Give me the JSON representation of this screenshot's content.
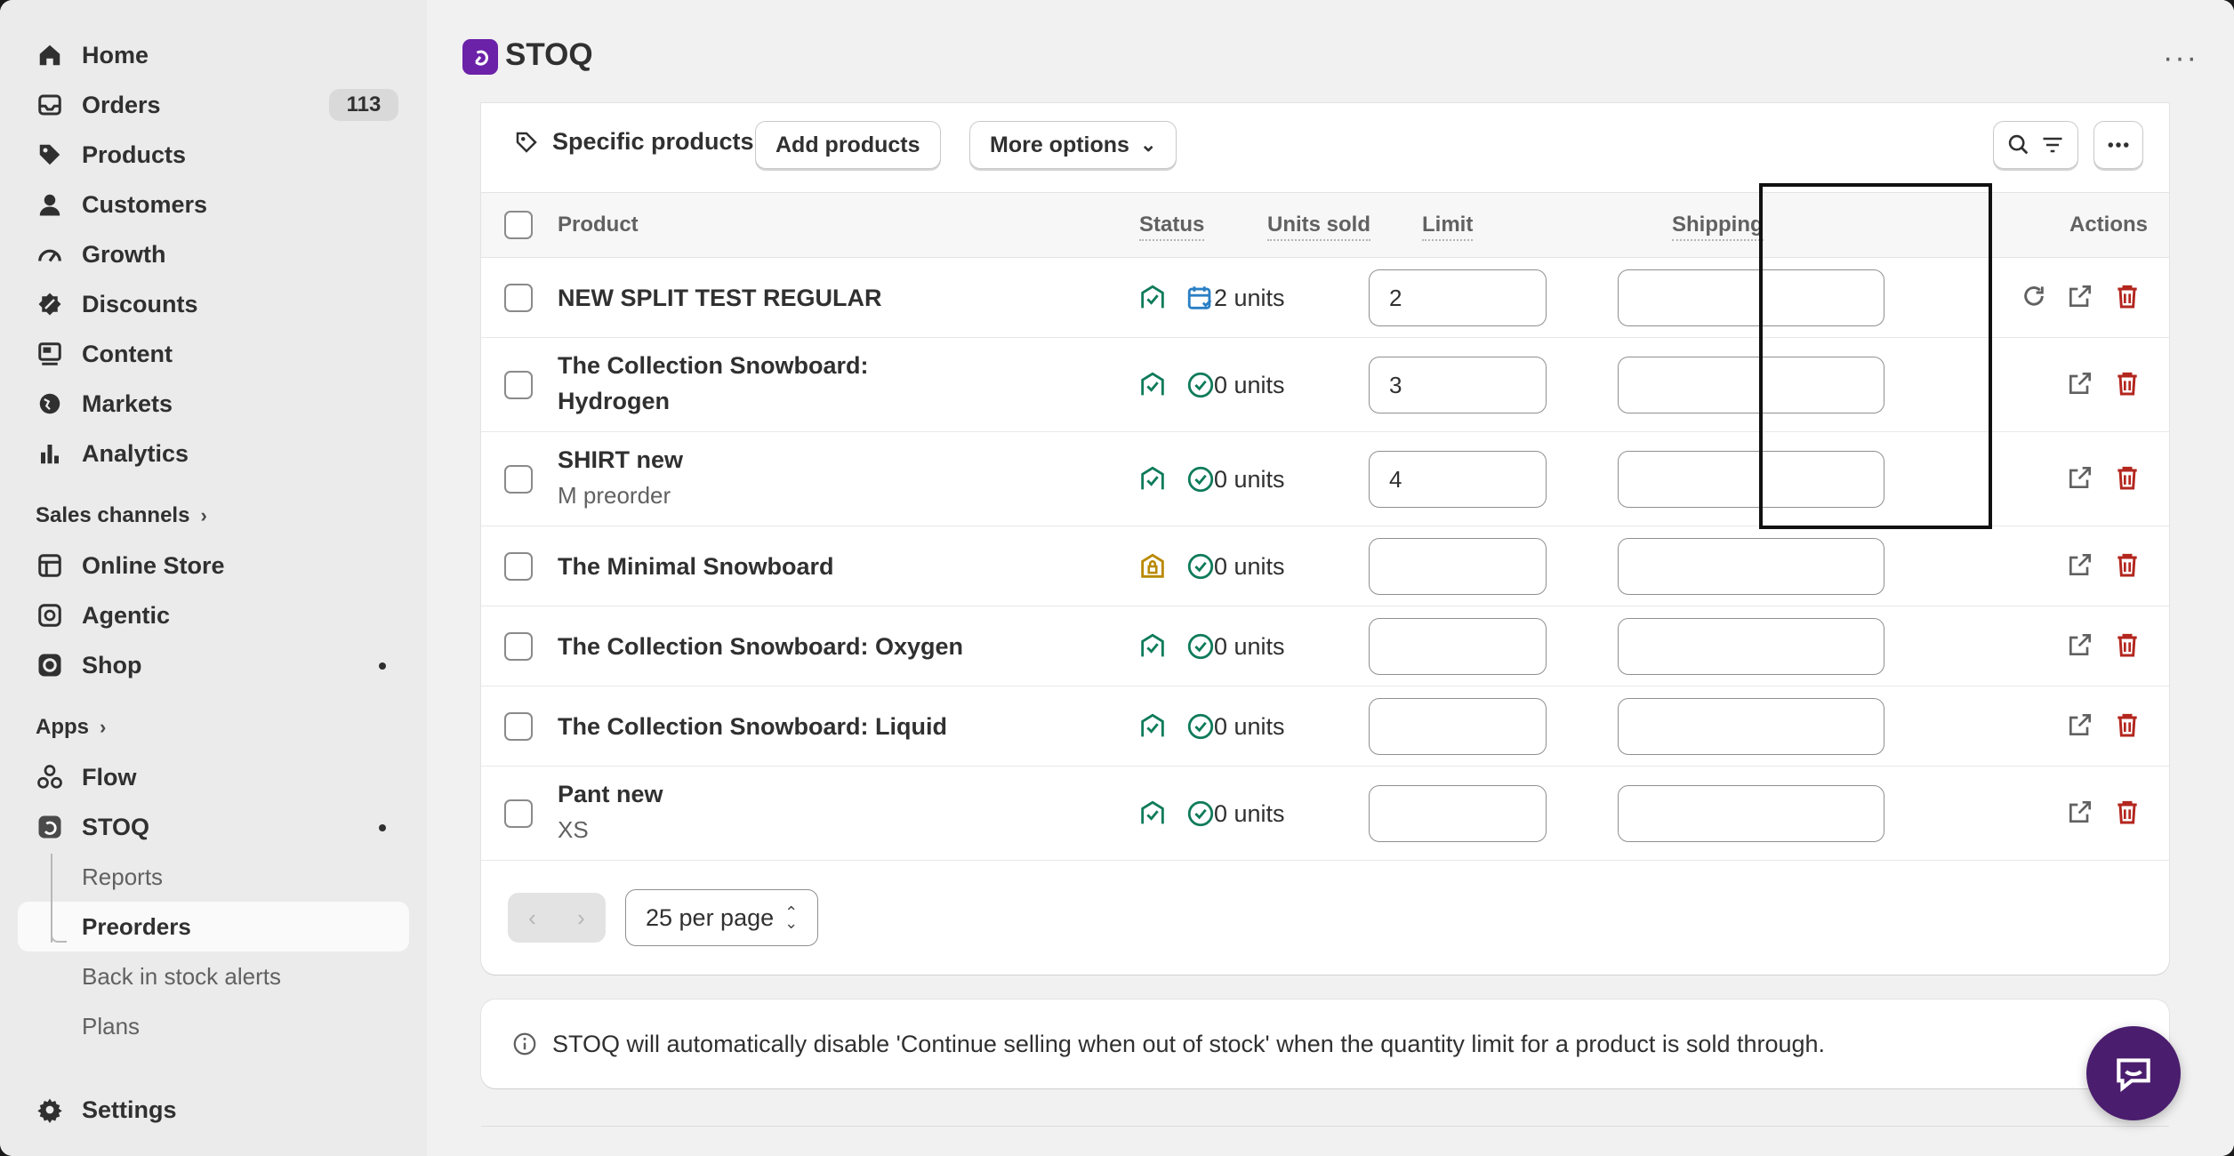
{
  "sidebar": {
    "items": [
      {
        "label": "Home",
        "icon": "home-icon"
      },
      {
        "label": "Orders",
        "icon": "inbox-icon",
        "badge": "113"
      },
      {
        "label": "Products",
        "icon": "tag-icon"
      },
      {
        "label": "Customers",
        "icon": "person-icon"
      },
      {
        "label": "Growth",
        "icon": "gauge-icon"
      },
      {
        "label": "Discounts",
        "icon": "discount-icon"
      },
      {
        "label": "Content",
        "icon": "content-icon"
      },
      {
        "label": "Markets",
        "icon": "globe-icon"
      },
      {
        "label": "Analytics",
        "icon": "bar-chart-icon"
      }
    ],
    "sales_channels_label": "Sales channels",
    "channels": [
      {
        "label": "Online Store",
        "icon": "store-icon"
      },
      {
        "label": "Agentic",
        "icon": "agentic-icon"
      },
      {
        "label": "Shop",
        "icon": "shop-icon"
      }
    ],
    "apps_label": "Apps",
    "apps": [
      {
        "label": "Flow",
        "icon": "flow-icon"
      },
      {
        "label": "STOQ",
        "icon": "stoq-icon"
      }
    ],
    "stoq_sub": [
      {
        "label": "Reports"
      },
      {
        "label": "Preorders",
        "active": true
      },
      {
        "label": "Back in stock alerts"
      },
      {
        "label": "Plans"
      }
    ],
    "settings_label": "Settings"
  },
  "header": {
    "title": "STOQ",
    "more": "···"
  },
  "toolbar": {
    "scope_label": "Specific products",
    "add_products": "Add products",
    "more_options": "More options"
  },
  "table": {
    "columns": {
      "product": "Product",
      "status": "Status",
      "units_sold": "Units sold",
      "limit": "Limit",
      "shipping": "Shipping",
      "actions": "Actions"
    },
    "rows": [
      {
        "name": "NEW SPLIT TEST REGULAR",
        "variant": "",
        "units": "2 units",
        "limit": "2",
        "shipping": "",
        "status_primary": "active",
        "status_secondary": "scheduled"
      },
      {
        "name": "The Collection Snowboard:",
        "name2": "Hydrogen",
        "variant": "",
        "units": "0 units",
        "limit": "3",
        "shipping": "",
        "status_primary": "active",
        "status_secondary": "check"
      },
      {
        "name": "SHIRT new",
        "variant": "M preorder",
        "units": "0 units",
        "limit": "4",
        "shipping": "",
        "status_primary": "active",
        "status_secondary": "check"
      },
      {
        "name": "The Minimal Snowboard",
        "variant": "",
        "units": "0 units",
        "limit": "",
        "shipping": "",
        "status_primary": "locked",
        "status_secondary": "check"
      },
      {
        "name": "The Collection Snowboard: Oxygen",
        "variant": "",
        "units": "0 units",
        "limit": "",
        "shipping": "",
        "status_primary": "active",
        "status_secondary": "check"
      },
      {
        "name": "The Collection Snowboard: Liquid",
        "variant": "",
        "units": "0 units",
        "limit": "",
        "shipping": "",
        "status_primary": "active",
        "status_secondary": "check"
      },
      {
        "name": "Pant new",
        "variant": "XS",
        "units": "0 units",
        "limit": "",
        "shipping": "",
        "status_primary": "active",
        "status_secondary": "check"
      }
    ]
  },
  "pagination": {
    "per_page": "25 per page"
  },
  "banner": {
    "text": "STOQ will automatically disable 'Continue selling when out of stock' when the quantity limit for a product is sold through."
  },
  "colors": {
    "accent_green": "#0f7b5a",
    "accent_blue": "#2a7fc4",
    "danger": "#b3261e",
    "warning": "#b98900",
    "brand": "#6b21a8"
  }
}
